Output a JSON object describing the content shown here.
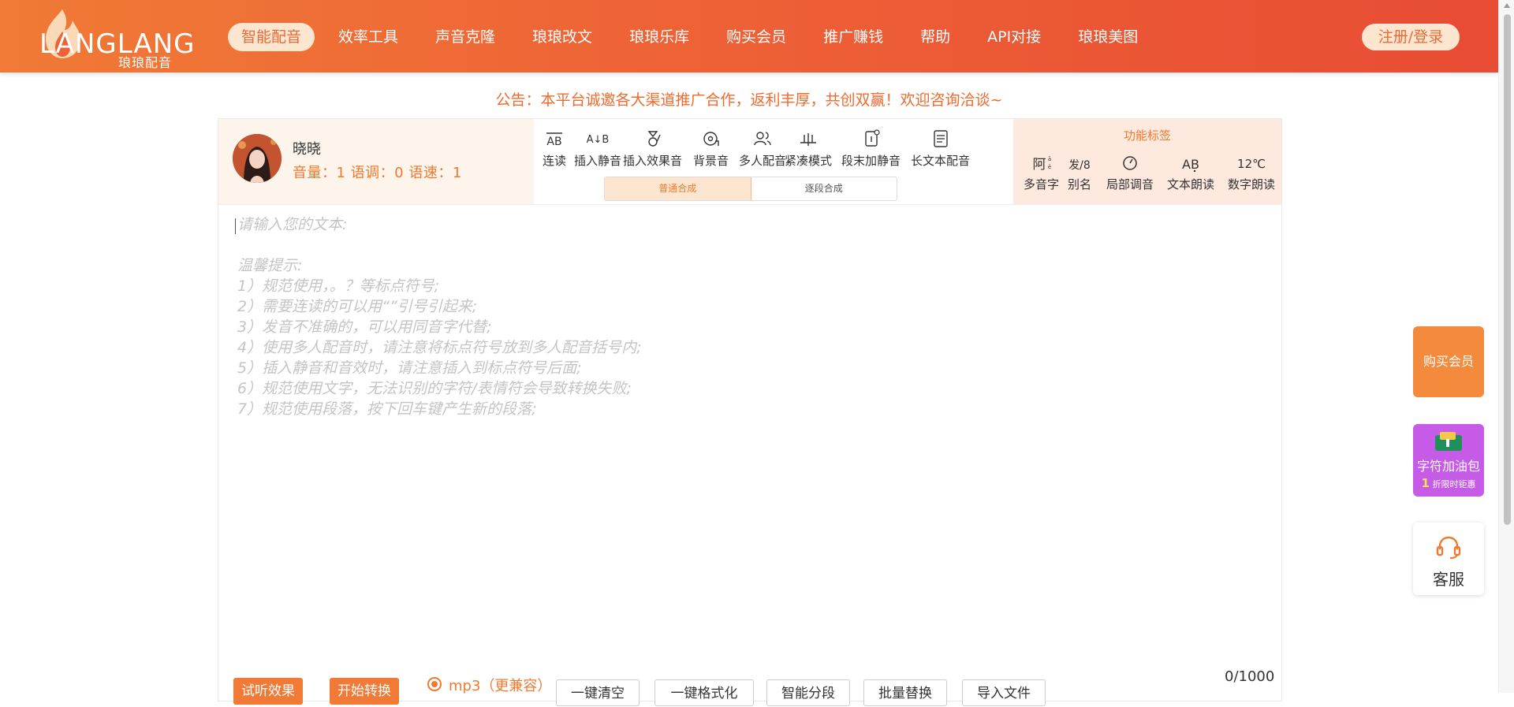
{
  "header": {
    "logo_text": "LANGLANG",
    "logo_sub": "琅琅配音",
    "nav": [
      {
        "label": "智能配音",
        "active": true
      },
      {
        "label": "效率工具"
      },
      {
        "label": "声音克隆"
      },
      {
        "label": "琅琅改文"
      },
      {
        "label": "琅琅乐库"
      },
      {
        "label": "购买会员"
      },
      {
        "label": "推广赚钱"
      },
      {
        "label": "帮助"
      },
      {
        "label": "API对接"
      },
      {
        "label": "琅琅美图"
      }
    ],
    "login": "注册/登录"
  },
  "announcement": "公告：本平台诚邀各大渠道推广合作，返利丰厚，共创双赢！欢迎咨询洽谈~",
  "voice": {
    "name": "晓晓",
    "params": "音量：1  语调：0  语速：1"
  },
  "tools": [
    {
      "label": "连读",
      "icon": "liandu-icon"
    },
    {
      "label": "插入静音",
      "icon": "insert-silence-icon"
    },
    {
      "label": "插入效果音",
      "icon": "sound-effect-icon"
    },
    {
      "label": "背景音",
      "icon": "background-music-icon"
    },
    {
      "label": "多人配音",
      "icon": "multi-voice-icon"
    },
    {
      "label": "紧凑模式",
      "icon": "compact-mode-icon"
    },
    {
      "label": "段末加静音",
      "icon": "paragraph-silence-icon"
    },
    {
      "label": "长文本配音",
      "icon": "long-text-icon"
    }
  ],
  "synth_tabs": [
    "普通合成",
    "逐段合成"
  ],
  "feature_title": "功能标签",
  "feature_tools": [
    {
      "label": "多音字",
      "glyph": "阿"
    },
    {
      "label": "别名",
      "glyph": "发/8"
    },
    {
      "label": "局部调音",
      "glyph": ""
    },
    {
      "label": "文本朗读",
      "glyph": "AB"
    },
    {
      "label": "数字朗读",
      "glyph": "12℃"
    }
  ],
  "editor": {
    "placeholder": "请输入您的文本:\n\n温馨提示:\n1）规范使用，。？等标点符号;\n2）需要连读的可以用“”引号引起来;\n3）发音不准确的，可以用同音字代替;\n4）使用多人配音时，请注意将标点符号放到多人配音括号内;\n5）插入静音和音效时，请注意插入到标点符号后面;\n6）规范使用文字，无法识别的字符/表情符会导致转换失败;\n7）规范使用段落，按下回车键产生新的段落;"
  },
  "bottom": {
    "preview": "试听效果",
    "convert": "开始转换",
    "format": "mp3（更兼容）",
    "buttons": [
      "一键清空",
      "一键格式化",
      "智能分段",
      "批量替换",
      "导入文件"
    ],
    "counter": "0/1000"
  },
  "float": {
    "vip": "购买会员",
    "pack_title": "字符加油包",
    "pack_num": "1",
    "pack_sub": "折限时钜惠",
    "service": "客服"
  },
  "colors": {
    "brand": "#ee6236",
    "accent": "#f07a30",
    "pack": "#c55be6"
  }
}
